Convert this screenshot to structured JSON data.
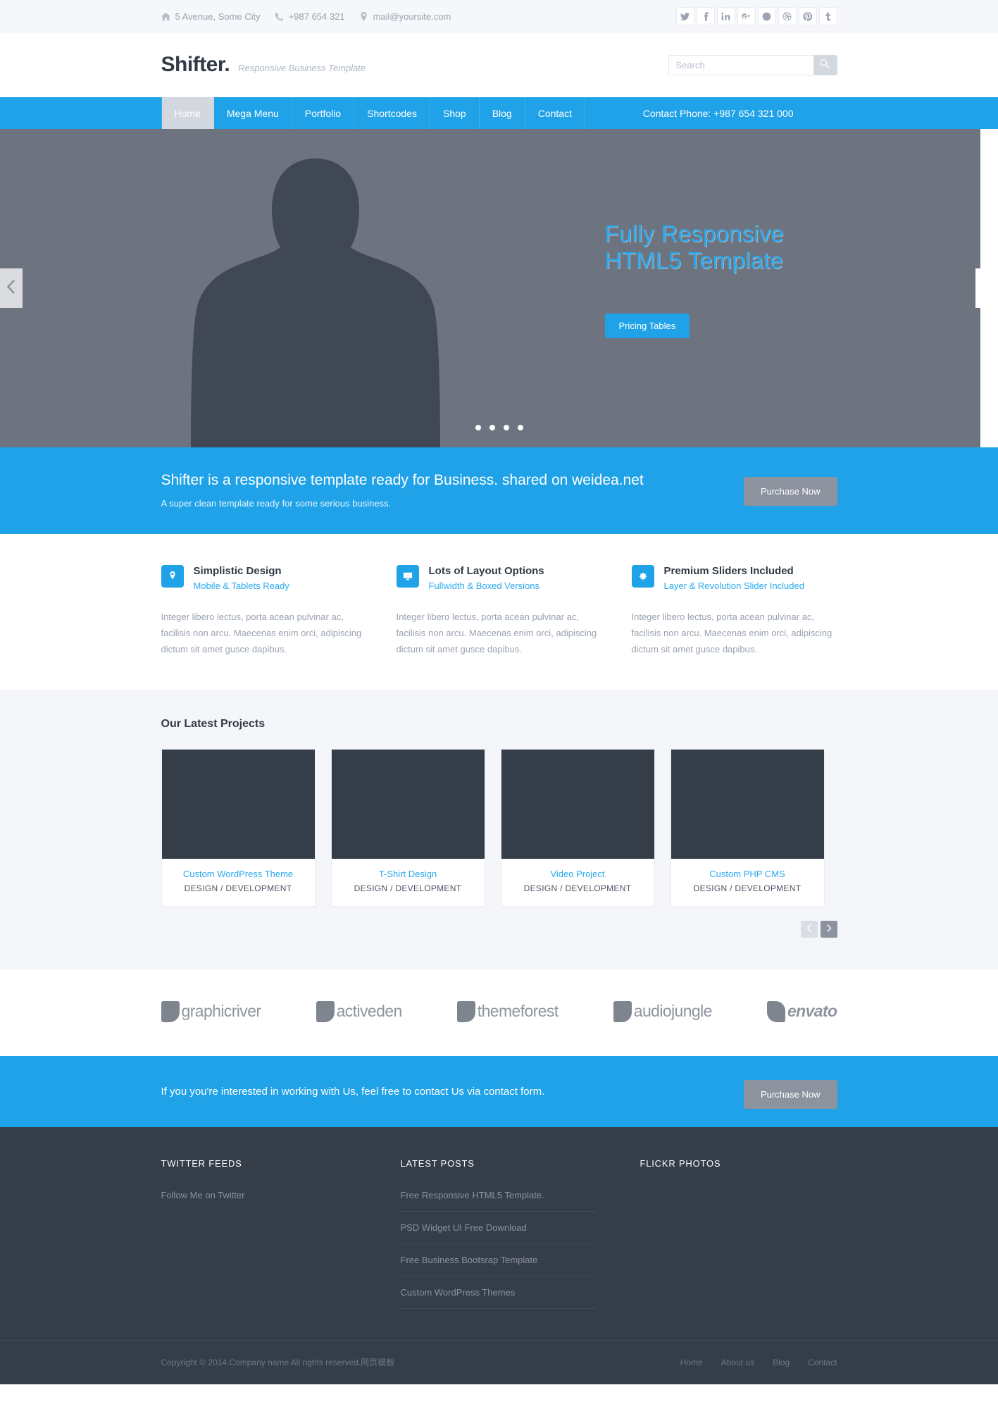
{
  "topbar": {
    "address": "5 Avenue, Some City",
    "phone": "+987 654 321",
    "email": "mail@yoursite.com",
    "social": [
      {
        "name": "twitter-icon",
        "glyph": "t"
      },
      {
        "name": "facebook-icon",
        "glyph": "f"
      },
      {
        "name": "linkedin-icon",
        "glyph": "in"
      },
      {
        "name": "googleplus-icon",
        "glyph": "g+"
      },
      {
        "name": "skype-icon",
        "glyph": "s"
      },
      {
        "name": "dribbble-icon",
        "glyph": "d"
      },
      {
        "name": "pinterest-icon",
        "glyph": "p"
      },
      {
        "name": "tumblr-icon",
        "glyph": "t"
      }
    ]
  },
  "header": {
    "logo": "Shifter.",
    "tagline": "Responsive Business Template",
    "search_placeholder": "Search",
    "search_value": ""
  },
  "nav": {
    "items": [
      {
        "label": "Home",
        "active": true
      },
      {
        "label": "Mega Menu",
        "active": false
      },
      {
        "label": "Portfolio",
        "active": false
      },
      {
        "label": "Shortcodes",
        "active": false
      },
      {
        "label": "Shop",
        "active": false
      },
      {
        "label": "Blog",
        "active": false
      },
      {
        "label": "Contact",
        "active": false
      }
    ],
    "phone": "Contact Phone: +987 654 321 000"
  },
  "slider": {
    "headline": "Fully Responsive HTML5 Template",
    "button": "Pricing Tables",
    "dots": 4,
    "active_dot": 1
  },
  "cta_top": {
    "headline": "Shifter is a responsive template ready for Business. shared on weidea.net",
    "subline": "A super clean template ready for some serious business.",
    "button": "Purchase Now"
  },
  "features": [
    {
      "icon": "map-pin-icon",
      "title": "Simplistic Design",
      "sub": "Mobile & Tablets Ready",
      "body": "Integer libero lectus, porta acean pulvinar ac, facilisis non arcu. Maecenas enim orci, adipiscing dictum sit amet gusce dapibus."
    },
    {
      "icon": "monitor-icon",
      "title": "Lots of Layout Options",
      "sub": "Fullwidth & Boxed Versions",
      "body": "Integer libero lectus, porta acean pulvinar ac, facilisis non arcu. Maecenas enim orci, adipiscing dictum sit amet gusce dapibus."
    },
    {
      "icon": "gear-icon",
      "title": "Premium Sliders Included",
      "sub": "Layer & Revolution Slider Included",
      "body": "Integer libero lectus, porta acean pulvinar ac, facilisis non arcu. Maecenas enim orci, adipiscing dictum sit amet gusce dapibus."
    }
  ],
  "projects": {
    "title": "Our Latest Projects",
    "items": [
      {
        "title": "Custom WordPress Theme",
        "category": "DESIGN / DEVELOPMENT"
      },
      {
        "title": "T-Shirt Design",
        "category": "DESIGN / DEVELOPMENT"
      },
      {
        "title": "Video Project",
        "category": "DESIGN / DEVELOPMENT"
      },
      {
        "title": "Custom PHP CMS",
        "category": "DESIGN / DEVELOPMENT"
      }
    ]
  },
  "brands": [
    {
      "name": "graphicriver",
      "label": "graphicriver"
    },
    {
      "name": "activeden",
      "label": "activeden"
    },
    {
      "name": "themeforest",
      "label": "themeforest"
    },
    {
      "name": "audiojungle",
      "label": "audiojungle"
    },
    {
      "name": "envato",
      "label": "envato"
    }
  ],
  "cta_bottom": {
    "text": "If you you're interested in working with Us, feel free to contact Us via contact form.",
    "button": "Purchase Now"
  },
  "footer": {
    "twitter": {
      "title": "TWITTER FEEDS",
      "text": "Follow Me on Twitter"
    },
    "posts": {
      "title": "LATEST POSTS",
      "items": [
        "Free Responsive HTML5 Template.",
        "PSD Widget UI Free Download",
        "Free Business Bootsrap Template",
        "Custom WordPress Themes"
      ]
    },
    "flickr": {
      "title": "FLICKR PHOTOS"
    },
    "copyright": "Copyright © 2014.Company name All rights reserved.网页模板",
    "links": [
      "Home",
      "About us",
      "Blog",
      "Contact"
    ]
  },
  "colors": {
    "accent": "#1fa2e8",
    "dark": "#343d48",
    "grey": "#8d939e",
    "light_bg": "#f4f6f9"
  }
}
